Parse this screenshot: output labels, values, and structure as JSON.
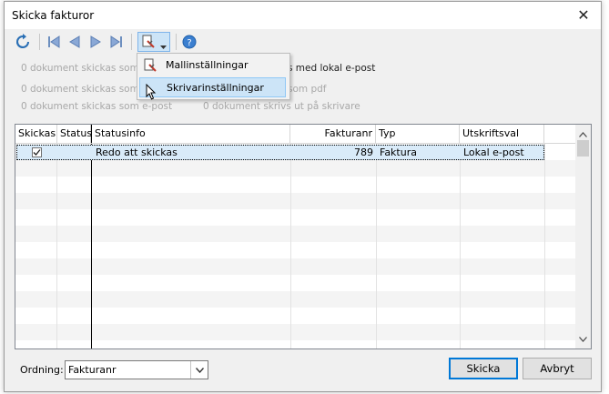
{
  "window": {
    "title": "Skicka fakturor",
    "close_symbol": "✕"
  },
  "toolbar": {
    "items": [
      "refresh-icon",
      "first-icon",
      "prev-icon",
      "next-icon",
      "last-icon",
      "settings-split-button",
      "help-icon"
    ]
  },
  "summary": {
    "left": [
      "0 dokument skickas som e",
      "0 dokument skickas som b",
      "0 dokument skickas som e-post"
    ],
    "right": [
      "s med lokal e-post",
      "som pdf",
      "0 dokument skrivs ut på skrivare"
    ]
  },
  "menu": {
    "items": [
      {
        "label": "Mallinställningar"
      },
      {
        "label": "Skrivarinställningar"
      }
    ]
  },
  "grid": {
    "columns": [
      "Skickas",
      "Status",
      "Statusinfo",
      "Fakturanr",
      "Typ",
      "Utskriftsval"
    ],
    "rows": [
      {
        "skickas": true,
        "status": "",
        "statusinfo": "Redo att skickas",
        "fakturanr": "789",
        "typ": "Faktura",
        "utskriftsval": "Lokal e-post"
      }
    ]
  },
  "footer": {
    "ordning_label": "Ordning:",
    "ordning_value": "Fakturanr",
    "send_button": "Skicka",
    "cancel_button": "Avbryt"
  }
}
